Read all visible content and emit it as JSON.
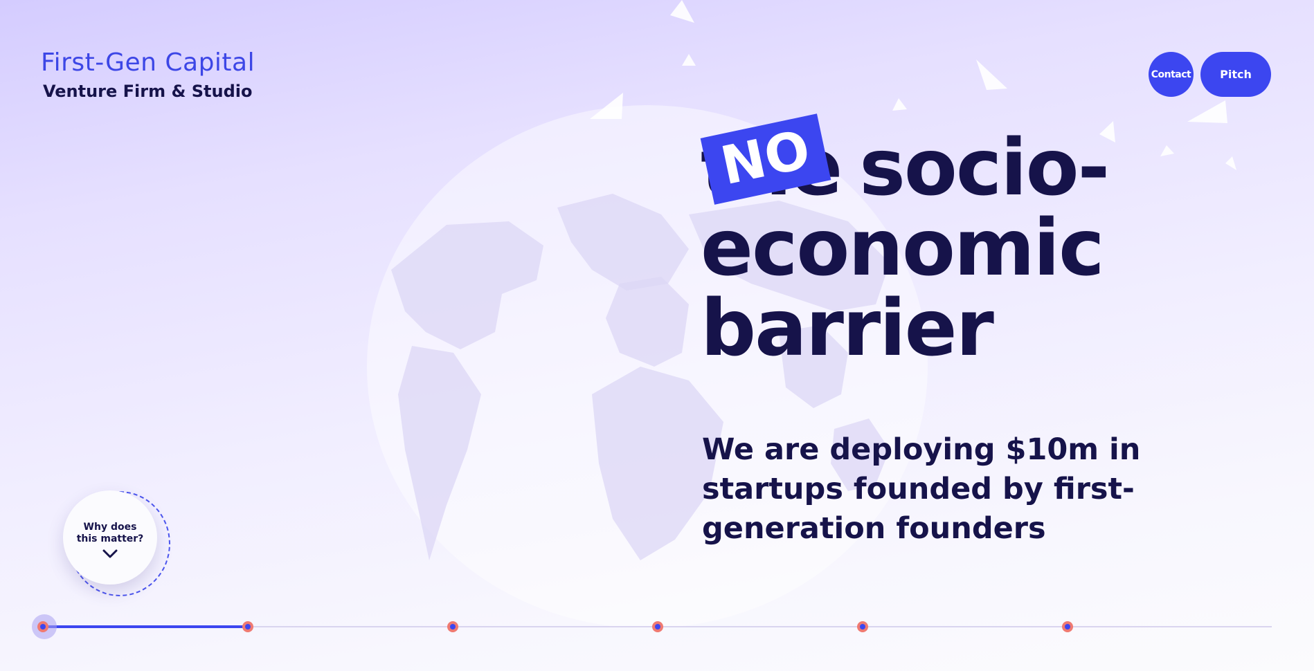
{
  "brand": {
    "name": "First-Gen Capital",
    "tagline": "Venture Firm & Studio"
  },
  "nav": {
    "contact_label": "Contact",
    "pitch_label": "Pitch"
  },
  "hero": {
    "struck_word": "the",
    "badge_word": "NO",
    "line1": "socio-",
    "line2": "economic",
    "line3": "barrier",
    "subheading": "We are deploying $10m in startups founded by first-generation founders"
  },
  "why": {
    "label": "Why does this matter?",
    "icon": "chevron-down-icon"
  },
  "timeline": {
    "step_count": 6,
    "active_step": 1,
    "progress": 0.167
  },
  "colors": {
    "accent": "#3c46f0",
    "text": "#16134a",
    "dot": "#ef7a72",
    "background_top": "#d4ccff",
    "background_bottom": "#fbfbfd"
  }
}
